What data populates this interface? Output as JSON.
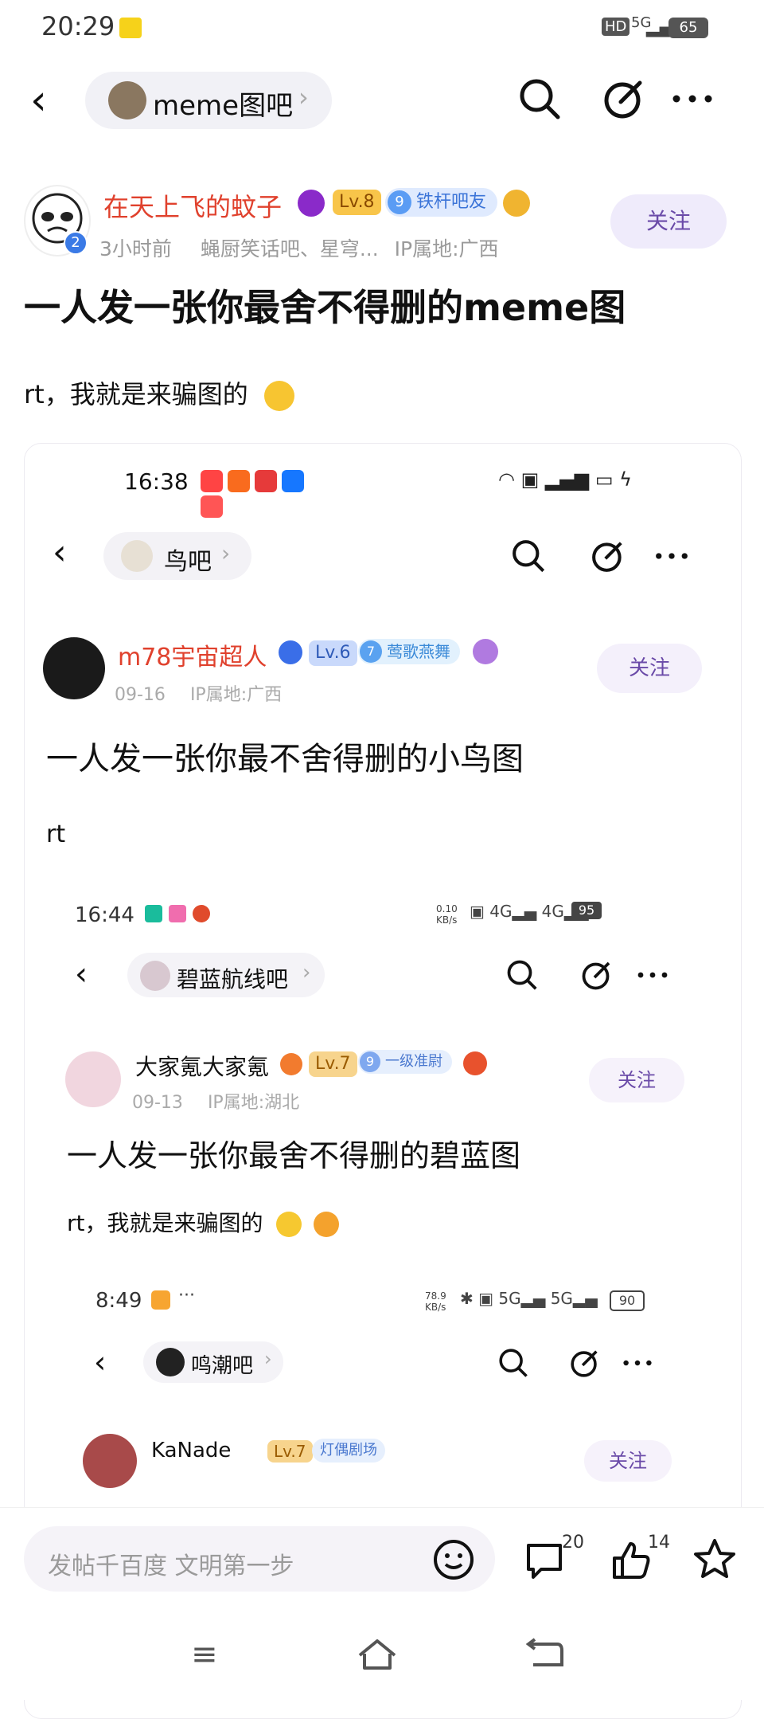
{
  "status": {
    "time": "20:29",
    "battery": "65",
    "network": "5G",
    "hd": "HD"
  },
  "forum": {
    "name": "meme图吧"
  },
  "post": {
    "author": "在天上飞的蚊子",
    "author_level": "Lv.8",
    "badge_number": "9",
    "badge_label": "铁杆吧友",
    "avatar_badge": "2",
    "meta_time": "3小时前",
    "meta_from": "蝇厨笑话吧、星穹...",
    "meta_ip": "IP属地:广西",
    "follow_label": "关注",
    "title": "一人发一张你最舍不得删的meme图",
    "body": "rt，我就是来骗图的"
  },
  "embed1": {
    "time": "16:38",
    "forum": "鸟吧",
    "author": "m78宇宙超人",
    "level": "Lv.6",
    "badge_number": "7",
    "badge_label": "莺歌燕舞",
    "meta_date": "09-16",
    "meta_ip": "IP属地:广西",
    "follow_label": "关注",
    "title": "一人发一张你最不舍得删的小鸟图",
    "body": "rt"
  },
  "embed2": {
    "time": "16:44",
    "netspeed": "0.10 KB/s",
    "battery": "95",
    "forum": "碧蓝航线吧",
    "author": "大家氪大家氪",
    "level": "Lv.7",
    "badge_number": "9",
    "badge_label": "一级准尉",
    "meta_date": "09-13",
    "meta_ip": "IP属地:湖北",
    "follow_label": "关注",
    "title": "一人发一张你最舍不得删的碧蓝图",
    "body": "rt，我就是来骗图的"
  },
  "embed3": {
    "time": "8:49",
    "netspeed": "78.9 KB/s",
    "battery": "90",
    "forum": "鸣潮吧",
    "author": "KaNade",
    "level": "Lv.7",
    "badge_label": "灯偶剧场",
    "follow_label": "关注"
  },
  "bottom": {
    "input_placeholder": "发帖千百度 文明第一步",
    "comment_count": "20",
    "like_count": "14"
  }
}
